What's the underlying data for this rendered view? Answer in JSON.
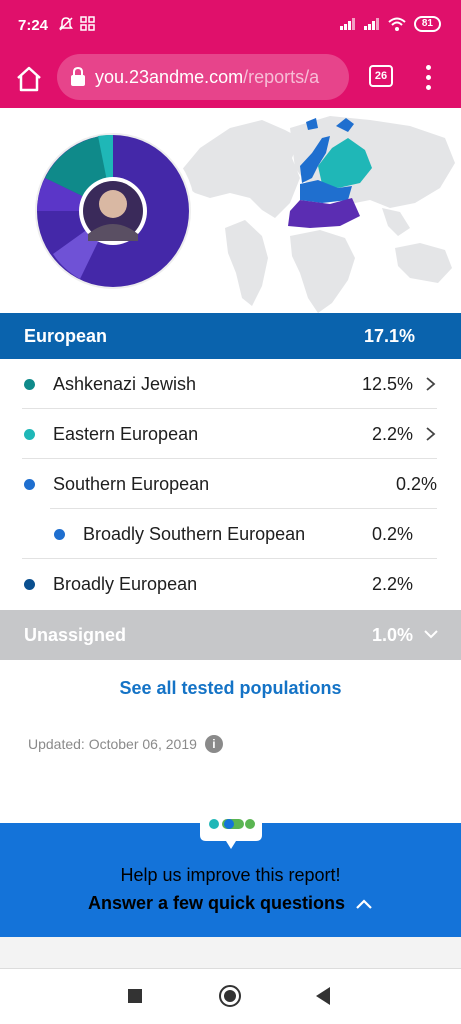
{
  "status_bar": {
    "time": "7:24",
    "battery": "81"
  },
  "browser": {
    "url_host": "you.23andme.com",
    "url_path": "/reports/a",
    "tab_count": "26"
  },
  "icons": {
    "home": "home-icon",
    "lock": "lock-icon",
    "menu": "more-vert-icon",
    "chevron_right": "chevron-right-icon",
    "chevron_down": "chevron-down-icon",
    "info": "info-icon"
  },
  "colors": {
    "brand_pink": "#e0106b",
    "european_blue": "#0a63ad",
    "ashkenazi": "#0f8a8a",
    "eastern": "#1fb7b7",
    "southern": "#1f6fcf",
    "broadly": "#0a4f8f",
    "unassigned": "#c6c7c9",
    "link": "#1473c6",
    "feedback_bg": "#1473d9"
  },
  "ancestry": {
    "category": {
      "name": "European",
      "percent": "17.1%"
    },
    "populations": [
      {
        "name": "Ashkenazi Jewish",
        "percent": "12.5%",
        "color": "#0f8a8a",
        "has_chevron": true,
        "indent": 0
      },
      {
        "name": "Eastern European",
        "percent": "2.2%",
        "color": "#1fb7b7",
        "has_chevron": true,
        "indent": 0
      },
      {
        "name": "Southern European",
        "percent": "0.2%",
        "color": "#1f6fcf",
        "has_chevron": false,
        "indent": 0
      },
      {
        "name": "Broadly Southern European",
        "percent": "0.2%",
        "color": "#1f6fcf",
        "has_chevron": false,
        "indent": 1
      },
      {
        "name": "Broadly European",
        "percent": "2.2%",
        "color": "#0a4f8f",
        "has_chevron": false,
        "indent": 0
      }
    ],
    "unassigned": {
      "name": "Unassigned",
      "percent": "1.0%"
    }
  },
  "links": {
    "see_all": "See all tested populations"
  },
  "updated": "Updated: October 06, 2019",
  "feedback": {
    "line1": "Help us improve this report!",
    "line2": "Answer a few quick questions"
  }
}
